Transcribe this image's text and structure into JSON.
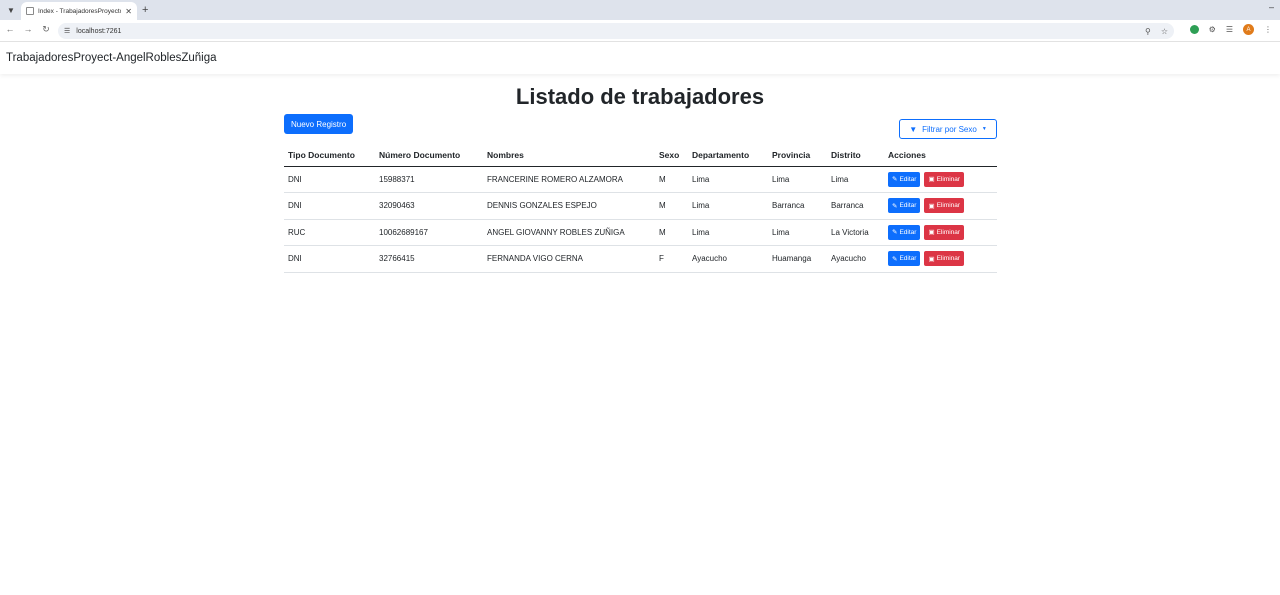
{
  "browser": {
    "tab_title": "Index - TrabajadoresProyecto A",
    "url": "localhost:7261"
  },
  "navbar": {
    "brand": "TrabajadoresProyect-AngelRoblesZuñiga"
  },
  "main": {
    "title": "Listado de trabajadores",
    "new_button_label": "Nuevo Registro",
    "filter_button_label": "Filtrar por Sexo"
  },
  "table": {
    "headers": [
      "Tipo Documento",
      "Número Documento",
      "Nombres",
      "Sexo",
      "Departamento",
      "Provincia",
      "Distrito",
      "Acciones"
    ],
    "edit_label": "Editar",
    "delete_label": "Eliminar",
    "rows": [
      [
        "DNI",
        "15988371",
        "FRANCERINE ROMERO ALZAMORA",
        "M",
        "Lima",
        "Lima",
        "Lima"
      ],
      [
        "DNI",
        "32090463",
        "DENNIS GONZALES ESPEJO",
        "M",
        "Lima",
        "Barranca",
        "Barranca"
      ],
      [
        "RUC",
        "10062689167",
        "ANGEL GIOVANNY ROBLES ZUÑIGA",
        "M",
        "Lima",
        "Lima",
        "La Victoria"
      ],
      [
        "DNI",
        "32766415",
        "FERNANDA VIGO CERNA",
        "F",
        "Ayacucho",
        "Huamanga",
        "Ayacucho"
      ]
    ]
  },
  "colors": {
    "primary": "#0d6efd",
    "danger": "#dc3545",
    "text": "#212529"
  },
  "icons": {
    "edit": "edit-icon",
    "delete": "trash-icon",
    "filter": "filter-icon"
  }
}
